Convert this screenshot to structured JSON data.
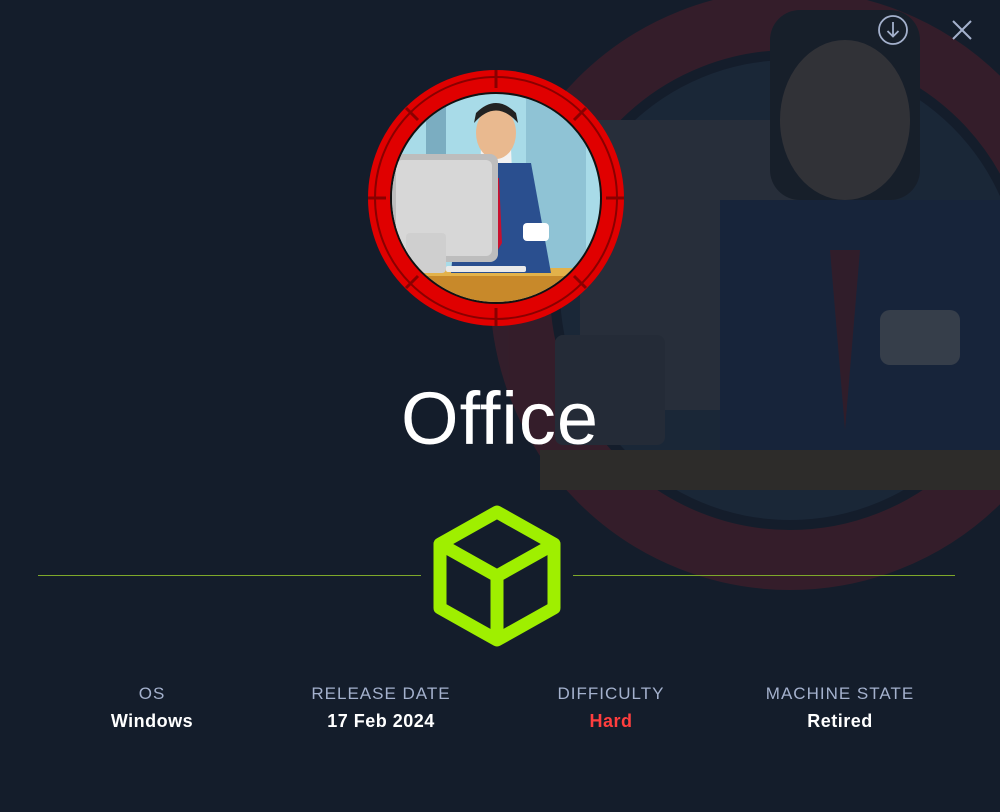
{
  "machine": {
    "name": "Office",
    "avatar_subject": "businessman-at-desk-with-coffee",
    "difficulty_color": "#ff3e3e"
  },
  "toolbar": {
    "download_icon": "download-circle-icon",
    "close_icon": "close-icon"
  },
  "stats": [
    {
      "label": "OS",
      "value": "Windows"
    },
    {
      "label": "RELEASE DATE",
      "value": "17 Feb 2024"
    },
    {
      "label": "DIFFICULTY",
      "value": "Hard"
    },
    {
      "label": "MACHINE STATE",
      "value": "Retired"
    }
  ],
  "colors": {
    "background": "#141d2b",
    "accent_green": "#9fef00",
    "divider": "#7ea82a",
    "label": "#a4b1cd",
    "ring_red": "#ff0000"
  }
}
